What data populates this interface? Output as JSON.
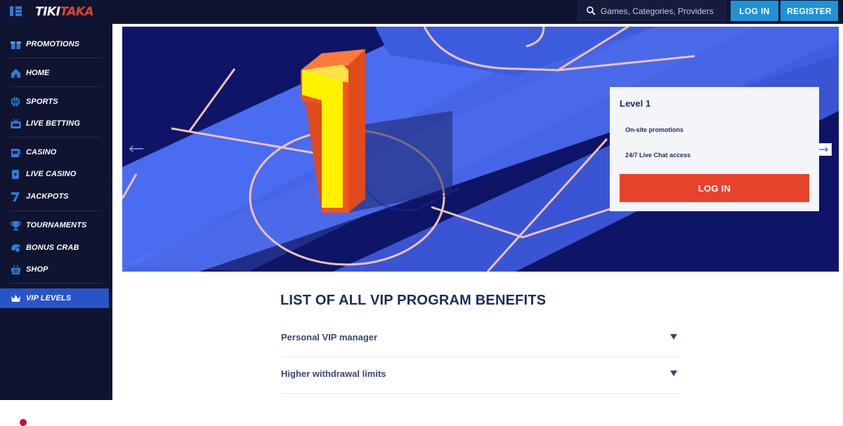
{
  "header": {
    "logo_a": "TIKI",
    "logo_b": "TAKA",
    "search_placeholder": "Games, Categories, Providers",
    "login_label": "LOG IN",
    "register_label": "REGISTER"
  },
  "sidebar": {
    "items": [
      {
        "label": "PROMOTIONS",
        "icon": "gift-icon"
      },
      {
        "label": "HOME",
        "icon": "home-icon"
      },
      {
        "label": "SPORTS",
        "icon": "basketball-icon"
      },
      {
        "label": "LIVE BETTING",
        "icon": "live-tv-icon"
      },
      {
        "label": "CASINO",
        "icon": "slot-machine-icon"
      },
      {
        "label": "LIVE CASINO",
        "icon": "playing-card-icon"
      },
      {
        "label": "JACKPOTS",
        "icon": "seven-icon"
      },
      {
        "label": "TOURNAMENTS",
        "icon": "trophy-icon"
      },
      {
        "label": "BONUS CRAB",
        "icon": "crab-icon"
      },
      {
        "label": "SHOP",
        "icon": "basket-icon"
      },
      {
        "label": "VIP LEVELS",
        "icon": "crown-icon",
        "active": true
      }
    ]
  },
  "banner": {
    "level_number": "1",
    "card": {
      "title": "Level 1",
      "benefit_1": "On-site promotions",
      "benefit_2": "24/7 Live Chat access",
      "login_label": "LOG IN"
    }
  },
  "benefits": {
    "heading": "LIST OF ALL VIP PROGRAM BENEFITS",
    "items": [
      "Personal VIP manager",
      "Higher withdrawal limits"
    ]
  },
  "colors": {
    "nav_bg": "#0f1430",
    "accent_blue": "#1e93d6",
    "accent_red": "#e8422a",
    "active_nav": "#2954c8"
  }
}
